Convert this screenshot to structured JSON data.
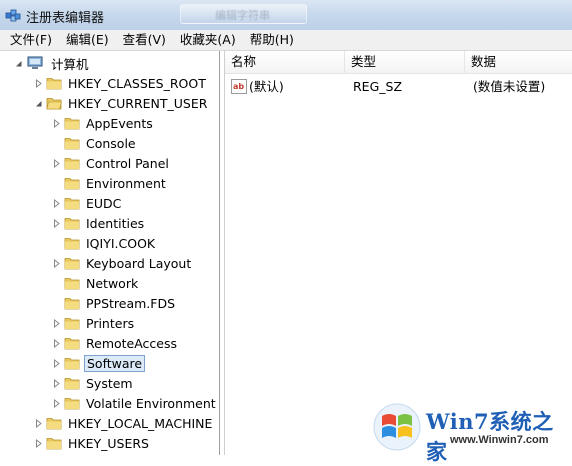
{
  "window": {
    "title": "注册表编辑器",
    "background_tab_label": "编辑字符串"
  },
  "menu": [
    "文件(F)",
    "编辑(E)",
    "查看(V)",
    "收藏夹(A)",
    "帮助(H)"
  ],
  "tree": {
    "root": "计算机",
    "nodes": [
      {
        "label": "HKEY_CLASSES_ROOT",
        "expanded": false
      },
      {
        "label": "HKEY_CURRENT_USER",
        "expanded": true
      },
      {
        "label": "AppEvents",
        "has_children": true
      },
      {
        "label": "Console",
        "has_children": false
      },
      {
        "label": "Control Panel",
        "has_children": true
      },
      {
        "label": "Environment",
        "has_children": false
      },
      {
        "label": "EUDC",
        "has_children": true
      },
      {
        "label": "Identities",
        "has_children": true
      },
      {
        "label": "IQIYI.COOK",
        "has_children": false
      },
      {
        "label": "Keyboard Layout",
        "has_children": true
      },
      {
        "label": "Network",
        "has_children": false
      },
      {
        "label": "PPStream.FDS",
        "has_children": false
      },
      {
        "label": "Printers",
        "has_children": true
      },
      {
        "label": "RemoteAccess",
        "has_children": true
      },
      {
        "label": "Software",
        "has_children": true,
        "selected": true
      },
      {
        "label": "System",
        "has_children": true
      },
      {
        "label": "Volatile Environment",
        "has_children": true
      },
      {
        "label": "HKEY_LOCAL_MACHINE",
        "expanded": false
      },
      {
        "label": "HKEY_USERS",
        "expanded": false
      }
    ]
  },
  "list": {
    "columns": [
      "名称",
      "类型",
      "数据"
    ],
    "rows": [
      {
        "name": "(默认)",
        "type": "REG_SZ",
        "data": "(数值未设置)",
        "icon": "string-value-icon"
      }
    ]
  },
  "watermark": {
    "title": "Win7系统之家",
    "url": "www.Winwin7.com"
  },
  "colors": {
    "folder": "#e8c860",
    "selection_bg": "#dceaf9",
    "selection_border": "#7da2ce",
    "watermark_blue": "#1f5fb5"
  }
}
